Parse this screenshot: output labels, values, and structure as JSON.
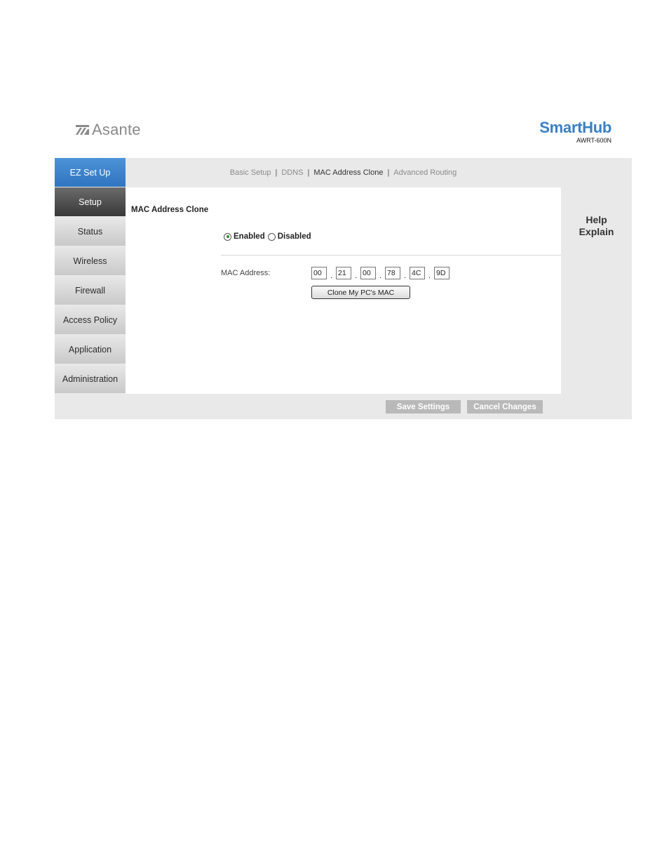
{
  "header": {
    "brand": "Asante",
    "product": "SmartHub",
    "model": "AWRT-600N"
  },
  "nav": {
    "items": [
      {
        "label": "EZ Set Up"
      },
      {
        "label": "Setup"
      },
      {
        "label": "Status"
      },
      {
        "label": "Wireless"
      },
      {
        "label": "Firewall"
      },
      {
        "label": "Access Policy"
      },
      {
        "label": "Application"
      },
      {
        "label": "Administration"
      }
    ],
    "active": "Setup"
  },
  "subnav": {
    "links": [
      "Basic Setup",
      "DDNS",
      "MAC Address Clone",
      "Advanced Routing"
    ],
    "separator": "|",
    "current": "MAC Address Clone"
  },
  "content": {
    "section_title": "MAC Address Clone",
    "radio": {
      "enabled_label": "Enabled",
      "disabled_label": "Disabled",
      "selected": "Enabled"
    },
    "mac_label": "MAC Address:",
    "mac_octets": [
      "00",
      "21",
      "00",
      "78",
      "4C",
      "9D"
    ],
    "mac_separator": ".",
    "clone_button": "Clone My PC's MAC"
  },
  "help": {
    "line1": "Help",
    "line2": "Explain"
  },
  "actions": {
    "save": "Save Settings",
    "cancel": "Cancel Changes"
  },
  "colors": {
    "accent_blue": "#3b80c4",
    "nav_active": "#383838",
    "radio_selected": "#2d8a2d",
    "button_grey": "#b9b9b9"
  }
}
